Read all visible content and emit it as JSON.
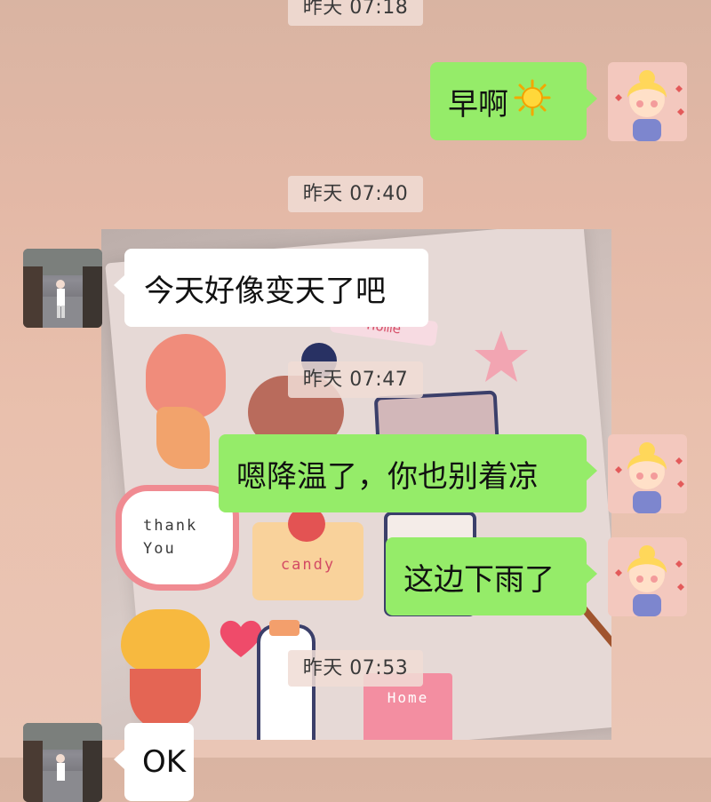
{
  "chat": {
    "timestamps": [
      "昨天 07:18",
      "昨天 07:40",
      "昨天 07:47",
      "昨天 07:53"
    ],
    "messages": [
      {
        "sender": "me",
        "text": "早啊",
        "icon": "sun-emoji"
      },
      {
        "sender": "other",
        "text": "今天好像变天了吧"
      },
      {
        "sender": "me",
        "text": "嗯降温了，你也别着凉"
      },
      {
        "sender": "me",
        "text": "这边下雨了"
      },
      {
        "sender": "other",
        "text": "OK"
      }
    ],
    "image_stickers": {
      "thank_you": "thank\nYou",
      "candy": "candy",
      "home": "Home",
      "home_top": "Home"
    }
  },
  "colors": {
    "outgoing_bubble": "#95ec69",
    "incoming_bubble": "#ffffff",
    "background": "#e3b8a6"
  }
}
